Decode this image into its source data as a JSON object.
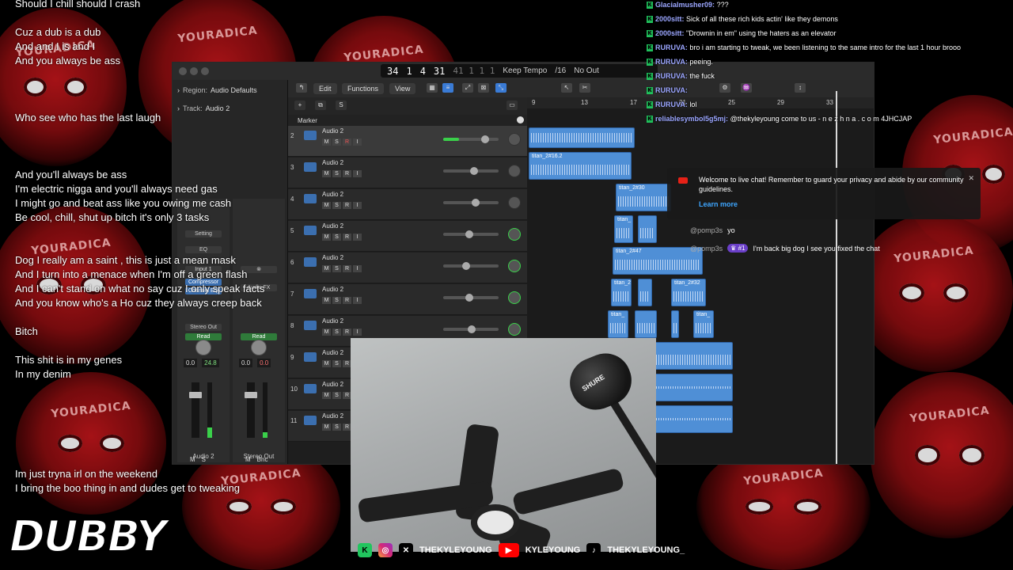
{
  "lyrics": [
    "Should I chill should I crash",
    "",
    "Cuz a dub is a dub",
    "And and I is and I",
    "And you always be ass",
    "",
    "",
    "",
    "Who see who has the last laugh",
    "",
    "",
    "",
    "And you'll always be ass",
    "I'm electric nigga and you'll always need gas",
    "I might go and beat ass like you owing me cash",
    "Be cool, chill, shut up bitch it's only 3 tasks",
    "",
    "",
    "Dog I really am a saint , this is just a mean mask",
    "And I turn into a menace when I'm off a green flash",
    "And I can't stand on what no say cuz I only speak facts",
    "And you know who's a Ho cuz they always creep back",
    "",
    "Bitch",
    "",
    "This shit is in my genes",
    "In my denim",
    "",
    "",
    "",
    "",
    "",
    "",
    "Im just tryna irl on the weekend",
    "I bring the boo thing in and dudes get to tweaking"
  ],
  "background_brand": "YOURADICA",
  "daw": {
    "lcd": {
      "bar": "34",
      "beat": "1",
      "div": "4",
      "tick": "31",
      "dim_position": "41 1 1 1",
      "tempo_mode": "Keep Tempo",
      "signature": "/16",
      "output": "No Out"
    },
    "inspector": {
      "region_label": "Region:",
      "region_value": "Audio Defaults",
      "track_label": "Track:",
      "track_value": "Audio 2",
      "setting": "Setting",
      "eq": "EQ",
      "input": "Input 1",
      "plugins": [
        "Compressor",
        "Channel EQ"
      ],
      "audio_fx": "Audio FX",
      "send": "Send",
      "stereo_out": "Stereo Out",
      "read": "Read",
      "strip_left": {
        "name": "Audio 2",
        "vol": "0.0",
        "peak": "24.8",
        "m": "M",
        "s": "S",
        "r": "R",
        "i": "I"
      },
      "strip_right": {
        "name": "Stereo Out",
        "vol": "0.0",
        "peak": "0.0",
        "m": "M",
        "bnc": "Bnc"
      }
    },
    "menus": [
      "Edit",
      "Functions",
      "View"
    ],
    "marker_label": "Marker",
    "ruler_ticks": [
      "9",
      "13",
      "17",
      "21",
      "25",
      "29",
      "33"
    ],
    "tracks": [
      {
        "num": "2",
        "name": "Audio 2",
        "pan_color": "#888888"
      },
      {
        "num": "3",
        "name": "Audio 2",
        "pan_color": "#888888"
      },
      {
        "num": "4",
        "name": "Audio 2",
        "pan_color": "#888888"
      },
      {
        "num": "5",
        "name": "Audio 2",
        "pan_color": "#3ad04a"
      },
      {
        "num": "6",
        "name": "Audio 2",
        "pan_color": "#3ad04a"
      },
      {
        "num": "7",
        "name": "Audio 2",
        "pan_color": "#3ad04a"
      },
      {
        "num": "8",
        "name": "Audio 2",
        "pan_color": "#3ad04a"
      },
      {
        "num": "9",
        "name": "Audio 2",
        "pan_color": "#888888"
      },
      {
        "num": "10",
        "name": "Audio 2",
        "pan_color": "#888888"
      },
      {
        "num": "11",
        "name": "Audio 2",
        "pan_color": "#888888"
      }
    ],
    "track_buttons": {
      "m": "M",
      "s": "S",
      "r": "R",
      "i": "I"
    },
    "region_labels": [
      "titan_2#16.2",
      "titan_2#30",
      "titan_2",
      "titan_2#47",
      "titan_2#32",
      "titan_2",
      "titan_"
    ]
  },
  "chat": [
    {
      "user": "Glacialmusher09:",
      "text": "???"
    },
    {
      "user": "2000sitt:",
      "text": "Sick of all these rich kids actin' like they demons"
    },
    {
      "user": "2000sitt:",
      "text": "\"Drownin in em\" using the haters as an elevator"
    },
    {
      "user": "RURUVA:",
      "text": "bro i am starting to tweak, we been listening to the same intro for the last 1 hour brooo"
    },
    {
      "user": "RURUVA:",
      "text": "peeing."
    },
    {
      "user": "RURUVA:",
      "text": "the fuck"
    },
    {
      "user": "RURUVA:",
      "text": ""
    },
    {
      "user": "RURUVA:",
      "text": "lol"
    },
    {
      "user": "reliablesymbol5g5mj:",
      "text": "@thekyleyoung come to us - n e z h n a . c o m 4JHCJAP"
    }
  ],
  "yt_notice": {
    "text": "Welcome to live chat! Remember to guard your privacy and abide by our community guidelines.",
    "learn_more": "Learn more"
  },
  "live_chat": [
    {
      "user": "@pomp3s",
      "rank": "",
      "text": "yo"
    },
    {
      "user": "@pomp3s",
      "rank": "#1",
      "text": "I'm back big dog I see you fixed the chat"
    }
  ],
  "webcam": {
    "mic_brand": "SHURE"
  },
  "socials": [
    {
      "icon": "kick-icon",
      "label": ""
    },
    {
      "icon": "instagram-icon",
      "label": ""
    },
    {
      "icon": "x-icon",
      "label": "THEKYLEYOUNG"
    },
    {
      "icon": "youtube-icon",
      "label": "KYLEYOUNG"
    },
    {
      "icon": "tiktok-icon",
      "label": "THEKYLEYOUNG_"
    }
  ],
  "logo": "DUBBY",
  "colors": {
    "accent_blue": "#4f8fd6",
    "chat_user": "#9ba6ff",
    "kick_green": "#21c55e",
    "bg_red": "#c2161b"
  }
}
